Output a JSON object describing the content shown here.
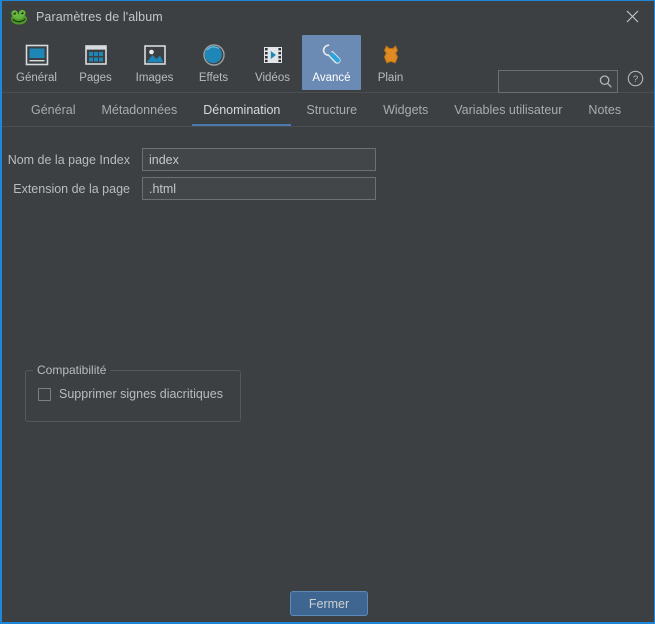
{
  "window": {
    "title": "Paramètres de l'album",
    "app_icon": "frog-icon",
    "close_icon": "close-icon",
    "accent_border": "#1f86d8",
    "background": "#3c4043"
  },
  "toolbar": {
    "items": [
      {
        "label": "Général",
        "icon": "monitor-icon",
        "selected": false
      },
      {
        "label": "Pages",
        "icon": "grid-icon",
        "selected": false
      },
      {
        "label": "Images",
        "icon": "picture-icon",
        "selected": false
      },
      {
        "label": "Effets",
        "icon": "sphere-icon",
        "selected": false
      },
      {
        "label": "Vidéos",
        "icon": "filmstrip-icon",
        "selected": false
      },
      {
        "label": "Avancé",
        "icon": "wrench-icon",
        "selected": true
      },
      {
        "label": "Plain",
        "icon": "hide-skin-icon",
        "selected": false
      }
    ],
    "selected_color": "#6b8bb5"
  },
  "search": {
    "value": "",
    "placeholder": "",
    "icon": "search-icon"
  },
  "help": {
    "icon": "help-circle-icon"
  },
  "tabs": {
    "items": [
      {
        "label": "Général",
        "active": false
      },
      {
        "label": "Métadonnées",
        "active": false
      },
      {
        "label": "Dénomination",
        "active": true
      },
      {
        "label": "Structure",
        "active": false
      },
      {
        "label": "Widgets",
        "active": false
      },
      {
        "label": "Variables utilisateur",
        "active": false
      },
      {
        "label": "Notes",
        "active": false
      }
    ],
    "active_underline_color": "#4a7ab0"
  },
  "form": {
    "index_page": {
      "label": "Nom de la page Index",
      "value": "index",
      "placeholder": ""
    },
    "page_extension": {
      "label": "Extension de la page",
      "value": ".html",
      "placeholder": ""
    },
    "compatibility": {
      "legend": "Compatibilité",
      "checkbox": {
        "label": "Supprimer signes diacritiques",
        "checked": false
      }
    }
  },
  "footer": {
    "close_label": "Fermer",
    "close_color": "#3f6690"
  }
}
